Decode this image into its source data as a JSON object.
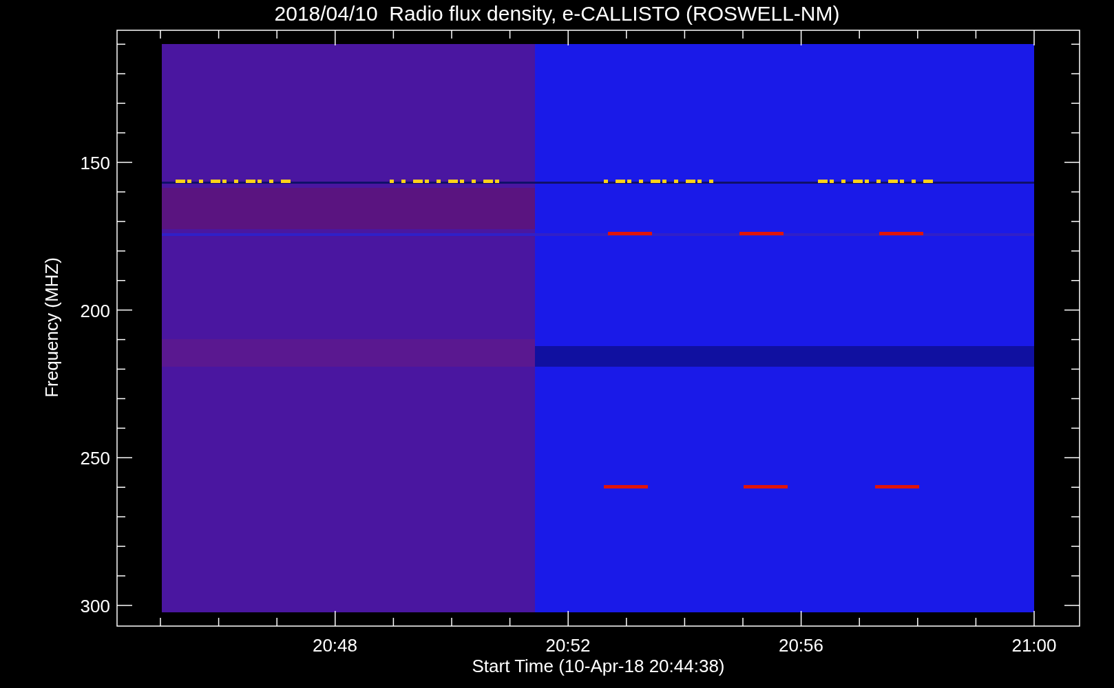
{
  "title": "2018/04/10  Radio flux density, e-CALLISTO (ROSWELL-NM)",
  "y_axis": {
    "label": "Frequency (MHZ)",
    "ticks": [
      "150",
      "200",
      "250",
      "300"
    ]
  },
  "x_axis": {
    "label": "Start Time (10-Apr-18 20:44:38)",
    "ticks": [
      "20:48",
      "20:52",
      "20:56",
      "21:00"
    ]
  }
}
